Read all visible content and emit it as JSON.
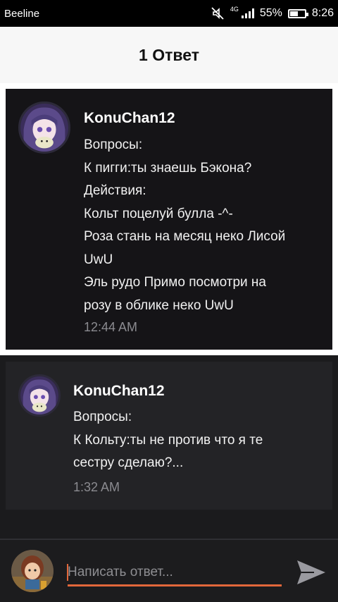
{
  "status_bar": {
    "carrier": "Beeline",
    "network": "4G",
    "battery_percent": "55%",
    "battery_level": 0.55,
    "time": "8:26",
    "icons": [
      "mute-icon",
      "signal-icon",
      "battery-icon"
    ]
  },
  "header": {
    "title": "1 Ответ"
  },
  "comments": [
    {
      "author": "KonuChan12",
      "lines": [
        "Вопросы:",
        "К пигги:ты знаешь Бэкона?",
        "Действия:",
        "Кольт поцелуй булла -^-",
        "Роза стань на месяц неко Лисой",
        "UwU",
        "Эль рудо Примо посмотри на",
        "розу в облике неко UwU"
      ],
      "time": "12:44 AM"
    },
    {
      "author": "KonuChan12",
      "lines": [
        "Вопросы:",
        "К Кольту:ты не против что я те",
        "сестру сделаю?..."
      ],
      "time": "1:32 AM"
    }
  ],
  "reply": {
    "placeholder": "Написать ответ...",
    "value": "",
    "accent_color": "#e2673a"
  },
  "colors": {
    "background": "#1b1b1d",
    "header_bg": "#f7f7f7",
    "card_dark": "#151417",
    "card_gray": "#232326"
  }
}
